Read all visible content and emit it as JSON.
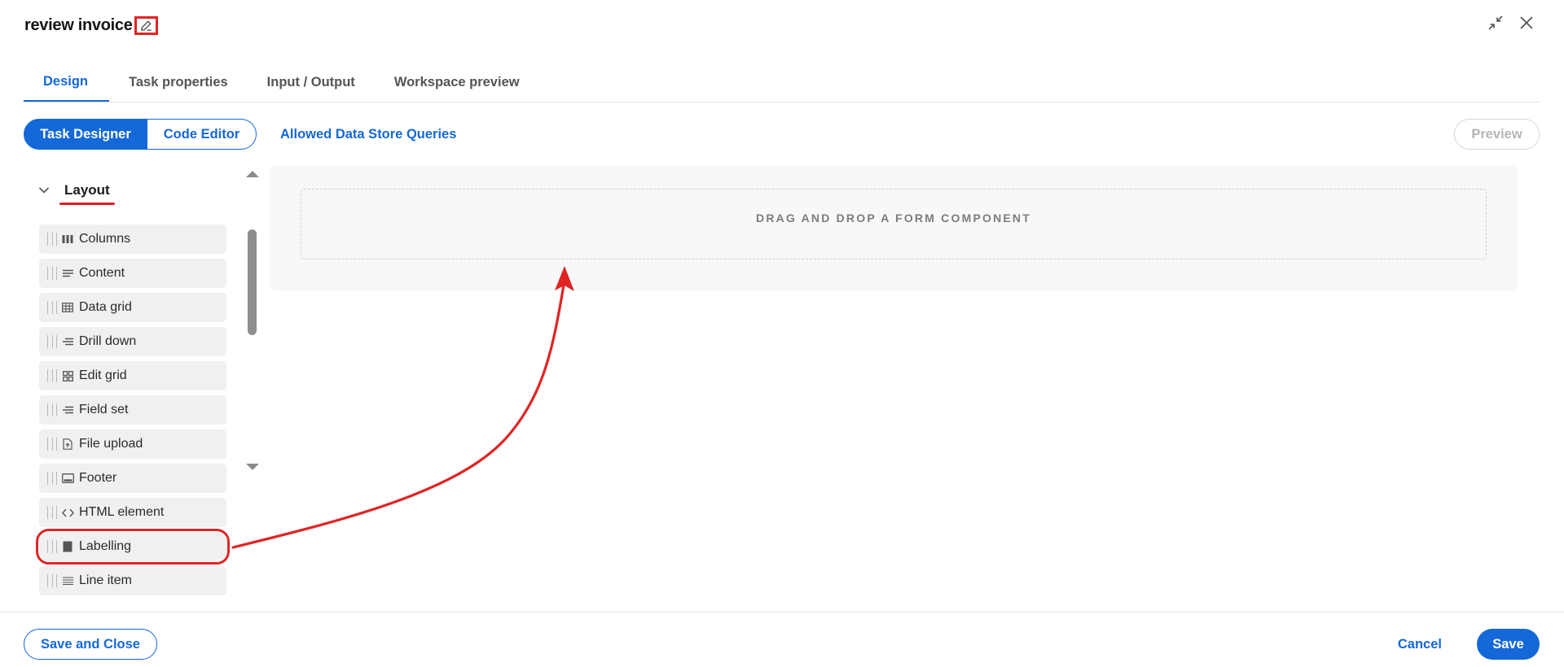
{
  "header": {
    "title": "review invoice",
    "edit_icon": "pencil-edit-icon",
    "minimize_icon": "collapse-arrows-icon",
    "close_icon": "close-icon"
  },
  "tabs": [
    {
      "label": "Design",
      "active": true
    },
    {
      "label": "Task properties",
      "active": false
    },
    {
      "label": "Input / Output",
      "active": false
    },
    {
      "label": "Workspace preview",
      "active": false
    }
  ],
  "toolbar": {
    "task_designer_label": "Task Designer",
    "code_editor_label": "Code Editor",
    "allowed_queries_label": "Allowed Data Store Queries",
    "preview_label": "Preview"
  },
  "sidebar": {
    "section_title": "Layout",
    "items": [
      {
        "label": "Columns",
        "icon": "columns-icon"
      },
      {
        "label": "Content",
        "icon": "content-lines-icon"
      },
      {
        "label": "Data grid",
        "icon": "data-grid-icon"
      },
      {
        "label": "Drill down",
        "icon": "drill-down-icon"
      },
      {
        "label": "Edit grid",
        "icon": "edit-grid-icon"
      },
      {
        "label": "Field set",
        "icon": "field-set-icon"
      },
      {
        "label": "File upload",
        "icon": "file-upload-icon"
      },
      {
        "label": "Footer",
        "icon": "footer-icon"
      },
      {
        "label": "HTML element",
        "icon": "code-brackets-icon"
      },
      {
        "label": "Labelling",
        "icon": "labelling-icon"
      },
      {
        "label": "Line item",
        "icon": "line-item-icon"
      }
    ]
  },
  "canvas": {
    "dropzone_text": "DRAG AND DROP A FORM COMPONENT"
  },
  "footer": {
    "save_close_label": "Save and Close",
    "cancel_label": "Cancel",
    "save_label": "Save"
  },
  "colors": {
    "accent": "#1468d8",
    "annotation_red": "#e02424"
  }
}
